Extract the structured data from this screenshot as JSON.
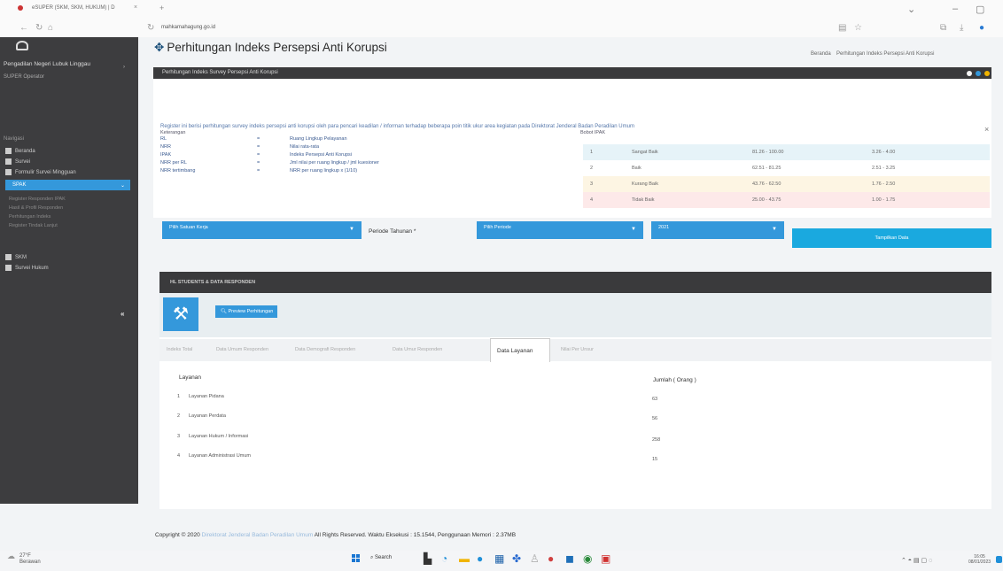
{
  "browser": {
    "tab_title": "eSUPER (SKM, SKM, HUKUM) | D",
    "tab_close": "×",
    "new_tab": "+",
    "url_prefix": "",
    "url_domain": "mahkamahagung.go.id",
    "url_path": ""
  },
  "sidebar": {
    "title": "Pengadilan Negeri Lubuk Linggau",
    "user": "SUPER Operator",
    "section_label": "Navigasi",
    "items": [
      {
        "label": "Beranda",
        "icon": "home-icon"
      },
      {
        "label": "Survei",
        "icon": "survey-icon"
      },
      {
        "label": "Formulir Survei Mingguan",
        "icon": "form-icon"
      }
    ],
    "active_item": "SPAK",
    "sub_items": [
      "Register Responden IPAK",
      "Hasil & Profil Responden",
      "Perhitungan Indeks",
      "Register Tindak Lanjut"
    ],
    "bottom_items": [
      {
        "label": "SKM",
        "icon": "chart-icon"
      },
      {
        "label": "Survei Hukum",
        "icon": "gavel-icon"
      }
    ],
    "collapse_glyph": "«"
  },
  "header": {
    "title": "Perhitungan Indeks Persepsi Anti Korupsi",
    "icon": "calculator-icon",
    "breadcrumb_home": "Beranda",
    "breadcrumb_current": "Perhitungan Indeks Persepsi Anti Korupsi"
  },
  "info_panel": {
    "title": "Perhitungan Indeks Survey Persepsi Anti Korupsi",
    "intro": "Register ini berisi perhitungan survey indeks persepsi anti korupsi oleh para pencari keadilan / informan terhadap beberapa poin titik ukur area kegiatan pada Direktorat Jenderal Badan Peradilan Umum",
    "keterangan_label": "Keterangan",
    "legend": [
      {
        "abbr": "RL",
        "desc": "Ruang Lingkup Pelayanan"
      },
      {
        "abbr": "NRR",
        "desc": "Nilai rata-rata"
      },
      {
        "abbr": "IPAK",
        "desc": "Indeks Persepsi Anti Korupsi"
      },
      {
        "abbr": "NRR per RL",
        "desc": "Jml nilai per ruang lingkup / jml kuesioner"
      },
      {
        "abbr": "NRR tertimbang",
        "desc": "NRR per ruang lingkup x (1/10)"
      }
    ],
    "bobot_label": "Bobot IPAK",
    "ipak_rows": [
      {
        "no": "1",
        "category": "Sangat Baik",
        "range": "81.26 - 100.00",
        "score": "3.26 - 4.00",
        "color": "#e6f3f8"
      },
      {
        "no": "2",
        "category": "Baik",
        "range": "62.51 - 81.25",
        "score": "2.51 - 3.25",
        "color": "#ffffff"
      },
      {
        "no": "3",
        "category": "Kurang Baik",
        "range": "43.76 - 62.50",
        "score": "1.76 - 2.50",
        "color": "#fdf5e3"
      },
      {
        "no": "4",
        "category": "Tidak Baik",
        "range": "25.00 - 43.75",
        "score": "1.00 - 1.75",
        "color": "#fde9e9"
      }
    ]
  },
  "filters": {
    "satuan_kerja": "Pilih Satuan Kerja",
    "periode_label": "Periode Tahunan *",
    "periode": "Pilih Periode",
    "tahun": "2021",
    "submit": "Tampilkan Data"
  },
  "results_panel": {
    "title": "HL STUDENTS & DATA RESPONDEN",
    "preview_button": "Preview Perhitungan",
    "tabs": [
      "Indeks Total",
      "Data Umum Responden",
      "Data Demografi Responden",
      "Data Umur Responden",
      "Data Layanan",
      "Nilai Per Unsur"
    ],
    "active_tab": "Data Layanan",
    "table": {
      "col_layanan": "Layanan",
      "col_jumlah": "Jumlah ( Orang )",
      "rows": [
        {
          "no": "1",
          "layanan": "Layanan Pidana",
          "jumlah": "63"
        },
        {
          "no": "2",
          "layanan": "Layanan Perdata",
          "jumlah": "56"
        },
        {
          "no": "3",
          "layanan": "Layanan Hukum / Informasi",
          "jumlah": "258"
        },
        {
          "no": "4",
          "layanan": "Layanan Administrasi Umum",
          "jumlah": "15"
        }
      ]
    }
  },
  "footer": {
    "copyright_prefix": "Copyright © 2020",
    "copyright_link": "Direktorat Jenderal Badan Peradilan Umum",
    "copyright_suffix": "All Rights Reserved. Waktu Eksekusi : 15.1544, Penggunaan Memori : 2.37MB"
  },
  "taskbar": {
    "weather_temp": "27°F",
    "weather_desc": "Berawan",
    "search": "Search",
    "time": "16:05",
    "date": "08/01/2023"
  }
}
